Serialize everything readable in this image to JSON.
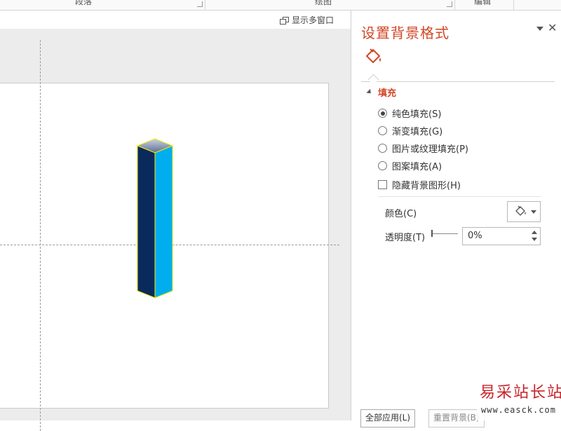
{
  "ribbon": {
    "groups": [
      "段落",
      "绘图",
      "编辑"
    ]
  },
  "workspace": {
    "multi_window_label": "显示多窗口"
  },
  "pane": {
    "title": "设置背景格式",
    "close": "✕",
    "section": "填充",
    "options": [
      {
        "label": "纯色填充(S)",
        "selected": true
      },
      {
        "label": "渐变填充(G)",
        "selected": false
      },
      {
        "label": "图片或纹理填充(P)",
        "selected": false
      },
      {
        "label": "图案填充(A)",
        "selected": false
      }
    ],
    "hide_graphics_label": "隐藏背景图形(H)",
    "hide_graphics_checked": false,
    "color_label": "颜色(C)",
    "transparency_label": "透明度(T)",
    "transparency_value": "0%",
    "transparency_level": 0,
    "apply_all_label": "全部应用(L)",
    "reset_label": "重置背景(B)"
  },
  "watermark": {
    "text": "易采站长站",
    "url": "www.easck.com"
  },
  "colors": {
    "accent": "#d24726",
    "shape_front": "#0a2a5c",
    "shape_side": "#00aeef",
    "shape_outline": "#f5e800"
  },
  "icons": {
    "fill_tab": "paint-bucket-icon",
    "multi_window": "multi-window-icon"
  }
}
